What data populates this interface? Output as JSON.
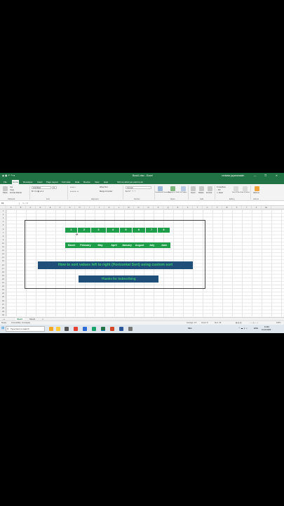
{
  "window": {
    "title": "Book1.xlsx - Excel",
    "user": "venkata jayaramaiah",
    "controls": [
      "—",
      "❐",
      "✕"
    ]
  },
  "ribbon_tabs": [
    "File",
    "Home",
    "Developer",
    "Insert",
    "Page Layout",
    "Formulas",
    "Data",
    "Review",
    "View",
    "Help",
    "Tell me what you want to do"
  ],
  "ribbon": {
    "clipboard": {
      "paste": "Paste",
      "cut": "Cut",
      "copy": "Copy",
      "format_painter": "Format Painter",
      "group": "Clipboard"
    },
    "font": {
      "font_name": "Arial Black",
      "font_size": "11",
      "group": "Font"
    },
    "alignment": {
      "wrap": "Wrap Text",
      "merge": "Merge & Center",
      "group": "Alignment"
    },
    "number": {
      "format": "General",
      "group": "Number"
    },
    "styles": {
      "conditional": "Conditional Formatting",
      "table": "Format as Table",
      "cell": "Cell Styles",
      "group": "Styles"
    },
    "cells": {
      "insert": "Insert",
      "delete": "Delete",
      "format": "Format",
      "group": "Cells"
    },
    "editing": {
      "autosum": "AutoSum",
      "fill": "Fill",
      "clear": "Clear",
      "sort": "Sort & Filter",
      "find": "Find & Select",
      "group": "Editing"
    },
    "addins": {
      "label": "Add-ins",
      "group": "Add-ins"
    }
  },
  "formula_bar": {
    "name_box": "K4",
    "fx": "fx",
    "value": ""
  },
  "columns": [
    "A",
    "B",
    "C",
    "D",
    "E",
    "F",
    "G",
    "H",
    "I",
    "J",
    "K",
    "L",
    "M",
    "N",
    "O",
    "P",
    "Q",
    "R",
    "S",
    "T",
    "U",
    "V",
    "W",
    "X",
    "Y",
    "Z",
    "AA"
  ],
  "rows": [
    "1",
    "2",
    "3",
    "4",
    "5",
    "6",
    "7",
    "8",
    "9",
    "10",
    "11",
    "12",
    "13",
    "14",
    "15",
    "16",
    "17",
    "18",
    "19",
    "20",
    "21",
    "22",
    "23",
    "24",
    "25",
    "26",
    "27",
    "28",
    "29",
    "30"
  ],
  "sheet": {
    "numbers": [
      "1",
      "2",
      "3",
      "4",
      "5",
      "6",
      "7",
      "8"
    ],
    "months": [
      "March",
      "February",
      "May",
      "April",
      "January",
      "August",
      "July",
      "June"
    ],
    "banner_title": "How to sort values left to right (Horizontal Sort) using custom sort",
    "banner_thanks": "Thanks for Subscribing"
  },
  "sheet_tabs": [
    "Sheet1",
    "Sheet2"
  ],
  "status": {
    "ready": "Ready",
    "accessibility": "Accessibility: Investigate",
    "average": "Average: 4.5",
    "count": "Count: 8",
    "sum": "Sum: 36",
    "zoom": "100%"
  },
  "taskbar": {
    "search_placeholder": "Type here to search",
    "weather": "Mist",
    "time": "11:32",
    "date": "21-10-2023",
    "lang": "ENG"
  },
  "colors": {
    "excel_green": "#217346",
    "cell_green": "#1e9e4a",
    "banner_blue": "#1f4e79",
    "banner_text": "#39d36b"
  }
}
